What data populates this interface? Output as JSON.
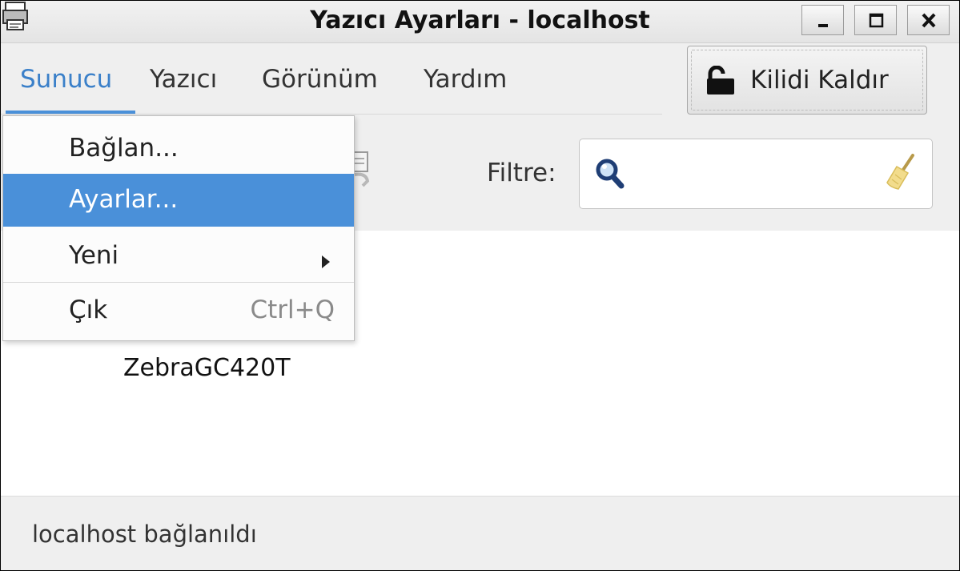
{
  "window": {
    "title": "Yazıcı Ayarları - localhost"
  },
  "menubar": {
    "items": [
      {
        "label": "Sunucu",
        "active": true
      },
      {
        "label": "Yazıcı"
      },
      {
        "label": "Görünüm"
      },
      {
        "label": "Yardım"
      }
    ]
  },
  "toolbar": {
    "unlock_label": "Kilidi Kaldır",
    "filter_label": "Filtre:",
    "filter_value": "",
    "filter_placeholder": ""
  },
  "dropdown": {
    "items": [
      {
        "label": "Bağlan..."
      },
      {
        "label": "Ayarlar...",
        "selected": true
      },
      {
        "label": "Yeni",
        "submenu": true
      },
      {
        "label": "Çık",
        "accel": "Ctrl+Q"
      }
    ]
  },
  "printers": [
    {
      "name": "ZebraGC420T"
    }
  ],
  "status": {
    "text": "localhost bağlanıldı"
  },
  "colors": {
    "accent": "#4a90d9",
    "active_menu_text": "#3b80c9"
  },
  "icons": {
    "app": "printer-icon",
    "unlock": "lock-icon",
    "search": "search-icon",
    "clear": "clear-broom-icon",
    "submenu": "chevron-right-icon"
  }
}
